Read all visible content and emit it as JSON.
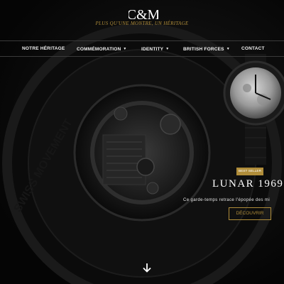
{
  "header": {
    "logo_text": "C&M",
    "tagline": "PLUS QU'UNE MONTRE, UN HÉRITAGE"
  },
  "nav": {
    "items": [
      {
        "label": "NOTRE HÉRITAGE",
        "dropdown": false
      },
      {
        "label": "COMMÉMORATION",
        "dropdown": true
      },
      {
        "label": "IDENTITY",
        "dropdown": true
      },
      {
        "label": "BRITISH FORCES",
        "dropdown": true
      },
      {
        "label": "CONTACT",
        "dropdown": false
      }
    ],
    "caret": "▼"
  },
  "hero": {
    "movement_engraving": "SWISS MOVEMENT",
    "badge": "BEST SELLER",
    "title": "LUNAR 1969",
    "description": "Ce garde-temps retrace l'épopée des mi",
    "cta_label": "DÉCOUVRIR",
    "scroll_icon": "arrow-down-icon"
  },
  "colors": {
    "gold": "#b08d3a",
    "background": "#050505"
  }
}
